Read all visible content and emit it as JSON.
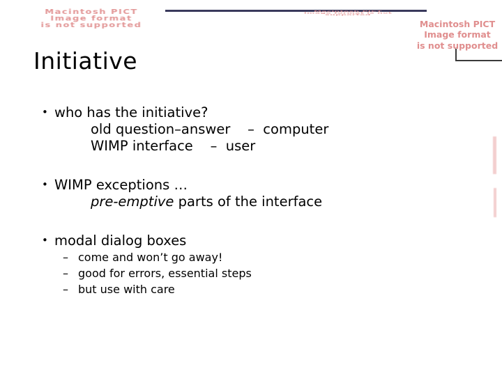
{
  "slide": {
    "title": "Initiative",
    "notices": [
      {
        "name": "pict-notice-top-left",
        "text": "Macintosh PICT\nImage format\nis not supported"
      },
      {
        "name": "pict-notice-top-middle",
        "text": "Macintosh PICT Image format is not supported"
      },
      {
        "name": "pict-notice-top-right",
        "text": "Macintosh PICT\nImage format\nis not supported"
      }
    ],
    "blocks": [
      {
        "bullet": "•",
        "heading": "who has the initiative?",
        "sublines": [
          {
            "text": "old question–answer    –  computer",
            "emphasis": ""
          },
          {
            "text": "WIMP interface    –  user",
            "emphasis": ""
          }
        ],
        "dashes": []
      },
      {
        "bullet": "•",
        "heading": "WIMP exceptions …",
        "sublines": [
          {
            "pre": "",
            "emphasis": "pre-emptive",
            "post": " parts of the interface"
          }
        ],
        "dashes": []
      },
      {
        "bullet": "•",
        "heading": "modal dialog boxes",
        "sublines": [],
        "dashes": [
          {
            "mark": "–",
            "text": "come and won’t go away!"
          },
          {
            "mark": "–",
            "text": "good for errors, essential steps"
          },
          {
            "mark": "–",
            "text": "but use with care"
          }
        ]
      }
    ],
    "colors": {
      "rule": "#3a3a5c",
      "notice_text": "#e08e8e",
      "body_text": "#000000",
      "background": "#ffffff"
    }
  }
}
